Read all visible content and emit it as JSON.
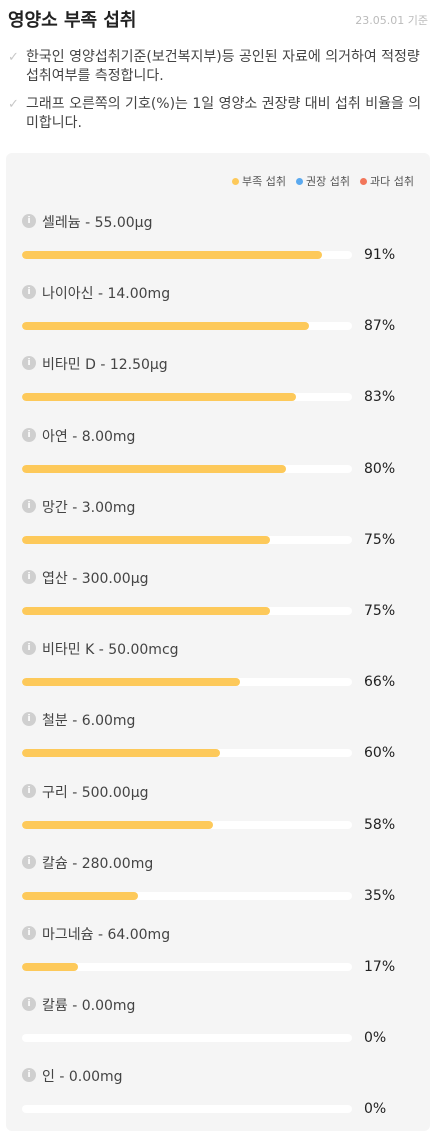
{
  "header": {
    "title": "영양소 부족 섭취",
    "date": "23.05.01 기준"
  },
  "notes": [
    "한국인 영양섭취기준(보건복지부)등 공인된 자료에 의거하여 적정량 섭취여부를 측정합니다.",
    "그래프 오른쪽의 기호(%)는 1일 영양소 권장량 대비 섭취 비율을 의미합니다."
  ],
  "legend": [
    {
      "label": "부족 섭취",
      "color": "#fdc95a"
    },
    {
      "label": "권장 섭취",
      "color": "#5aa9ef"
    },
    {
      "label": "과다 섭취",
      "color": "#f2765a"
    }
  ],
  "chart_data": {
    "type": "bar",
    "categories": [
      "셀레늄 - 55.00μg",
      "나이아신 - 14.00mg",
      "비타민 D - 12.50μg",
      "아연 - 8.00mg",
      "망간 - 3.00mg",
      "엽산 - 300.00μg",
      "비타민 K - 50.00mcg",
      "철분 - 6.00mg",
      "구리 - 500.00μg",
      "칼슘 - 280.00mg",
      "마그네슘 - 64.00mg",
      "칼륨 - 0.00mg",
      "인 - 0.00mg"
    ],
    "values": [
      91,
      87,
      83,
      80,
      75,
      75,
      66,
      60,
      58,
      35,
      17,
      0,
      0
    ],
    "value_labels": [
      "91%",
      "87%",
      "83%",
      "80%",
      "75%",
      "75%",
      "66%",
      "60%",
      "58%",
      "35%",
      "17%",
      "0%",
      "0%"
    ],
    "bar_color": "#fdc95a",
    "ylim": [
      0,
      100
    ]
  }
}
